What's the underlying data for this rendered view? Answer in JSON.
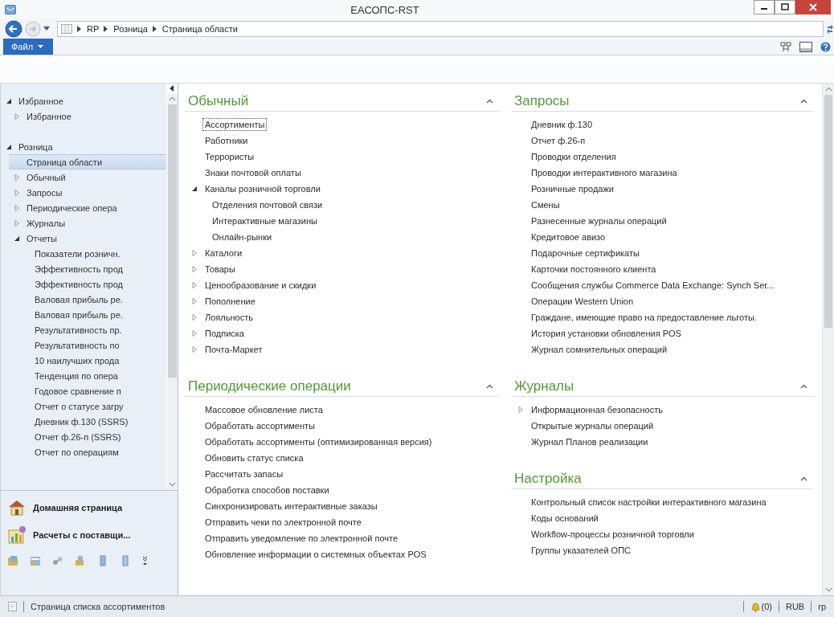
{
  "window": {
    "title": "ЕАСОПС-RST"
  },
  "address_bar": {
    "breadcrumbs": [
      "RP",
      "Розница",
      "Страница области"
    ]
  },
  "ribbon": {
    "file_menu": "Файл"
  },
  "sidebar": {
    "tree": [
      {
        "label": "Избранное",
        "expanded": true,
        "selected": false,
        "children": [
          {
            "label": "Избранное",
            "expanded": false,
            "selected": false
          }
        ]
      },
      {
        "label": "Розница",
        "expanded": true,
        "selected": false,
        "children": [
          {
            "label": "Страница области",
            "selected": true
          },
          {
            "label": "Обычный",
            "expanded": false,
            "selected": false
          },
          {
            "label": "Запросы",
            "expanded": false,
            "selected": false
          },
          {
            "label": "Периодические опера",
            "expanded": false,
            "selected": false
          },
          {
            "label": "Журналы",
            "expanded": false,
            "selected": false
          },
          {
            "label": "Отчеты",
            "expanded": true,
            "selected": false,
            "children": [
              {
                "label": "Показатели розничн.",
                "selected": false
              },
              {
                "label": "Эффективность прод",
                "selected": false
              },
              {
                "label": "Эффективность прод",
                "selected": false
              },
              {
                "label": "Валовая прибыль ре.",
                "selected": false
              },
              {
                "label": "Валовая прибыль ре.",
                "selected": false
              },
              {
                "label": "Результативность пр.",
                "selected": false
              },
              {
                "label": "Результативность по",
                "selected": false
              },
              {
                "label": "10 наилучших прода",
                "selected": false
              },
              {
                "label": "Тенденция по опера",
                "selected": false
              },
              {
                "label": "Годовое сравнение п",
                "selected": false
              },
              {
                "label": "Отчет о статусе загру",
                "selected": false
              },
              {
                "label": "Дневник ф.130 (SSRS)",
                "selected": false
              },
              {
                "label": "Отчет ф.26-п (SSRS)",
                "selected": false
              },
              {
                "label": "Отчет по операциям",
                "selected": false
              }
            ]
          }
        ]
      }
    ],
    "shortcuts": [
      {
        "kind": "home",
        "label": "Домашняя страница"
      },
      {
        "kind": "chart",
        "label": "Расчеты с поставщи..."
      }
    ]
  },
  "content": {
    "columns": [
      {
        "sections": [
          {
            "title": "Обычный",
            "items": [
              {
                "label": "Ассортименты",
                "focused": true
              },
              {
                "label": "Работники",
                "focused": false
              },
              {
                "label": "Террористы",
                "focused": false
              },
              {
                "label": "Знаки почтовой оплаты",
                "focused": false
              },
              {
                "label": "Каналы розничной торговли",
                "focused": false,
                "expanded": true,
                "children": [
                  {
                    "label": "Отделения почтовой связи",
                    "focused": false
                  },
                  {
                    "label": "Интерактивные магазины",
                    "focused": false
                  },
                  {
                    "label": "Онлайн-рынки",
                    "focused": false
                  }
                ]
              },
              {
                "label": "Каталоги",
                "focused": false,
                "expanded": false
              },
              {
                "label": "Товары",
                "focused": false,
                "expanded": false
              },
              {
                "label": "Ценообразование и скидки",
                "focused": false,
                "expanded": false
              },
              {
                "label": "Пополнение",
                "focused": false,
                "expanded": false
              },
              {
                "label": "Лояльность",
                "focused": false,
                "expanded": false
              },
              {
                "label": "Подписка",
                "focused": false,
                "expanded": false
              },
              {
                "label": "Почта-Маркет",
                "focused": false,
                "expanded": false
              }
            ]
          },
          {
            "title": "Периодические операции",
            "items": [
              {
                "label": "Массовое обновление листа"
              },
              {
                "label": "Обработать ассортименты"
              },
              {
                "label": "Обработать ассортименты (оптимизированная версия)"
              },
              {
                "label": "Обновить статус списка"
              },
              {
                "label": "Рассчитать запасы"
              },
              {
                "label": "Обработка способов поставки"
              },
              {
                "label": "Синхронизировать интерактивные заказы"
              },
              {
                "label": "Отправить чеки по электронной почте"
              },
              {
                "label": "Отправить уведомление по электронной почте"
              },
              {
                "label": "Обновление информации о системных объектах POS"
              }
            ]
          }
        ]
      },
      {
        "sections": [
          {
            "title": "Запросы",
            "items": [
              {
                "label": "Дневник ф.130"
              },
              {
                "label": "Отчет ф.26-п"
              },
              {
                "label": "Проводки отделения"
              },
              {
                "label": "Проводки интерактивного магазина"
              },
              {
                "label": "Розничные продажи"
              },
              {
                "label": "Смены"
              },
              {
                "label": "Разнесенные журналы операций"
              },
              {
                "label": "Кредитовое авизо"
              },
              {
                "label": "Подарочные сертификаты"
              },
              {
                "label": "Карточки постоянного клиента"
              },
              {
                "label": "Сообщения службы Commerce Data Exchange: Synch Ser..."
              },
              {
                "label": "Операции Western Union"
              },
              {
                "label": "Граждане, имеющие право на предоставление льготы."
              },
              {
                "label": "История установки обновления POS"
              },
              {
                "label": "Журнал сомнительных операций"
              }
            ]
          },
          {
            "title": "Журналы",
            "items": [
              {
                "label": "Информационная безопасность",
                "expanded": false
              },
              {
                "label": "Открытые журналы операций"
              },
              {
                "label": "Журнал Планов реализации"
              }
            ]
          },
          {
            "title": "Настройка",
            "items": [
              {
                "label": "Контрольный список настройки интерактивного магазина"
              },
              {
                "label": "Коды оснований"
              },
              {
                "label": "Workflow-процессы розничной торговли"
              },
              {
                "label": "Группы указателей ОПС"
              }
            ]
          }
        ]
      }
    ]
  },
  "status_bar": {
    "text": "Страница списка ассортиментов",
    "alerts": "(0)",
    "currency": "RUB",
    "company": "rp"
  }
}
